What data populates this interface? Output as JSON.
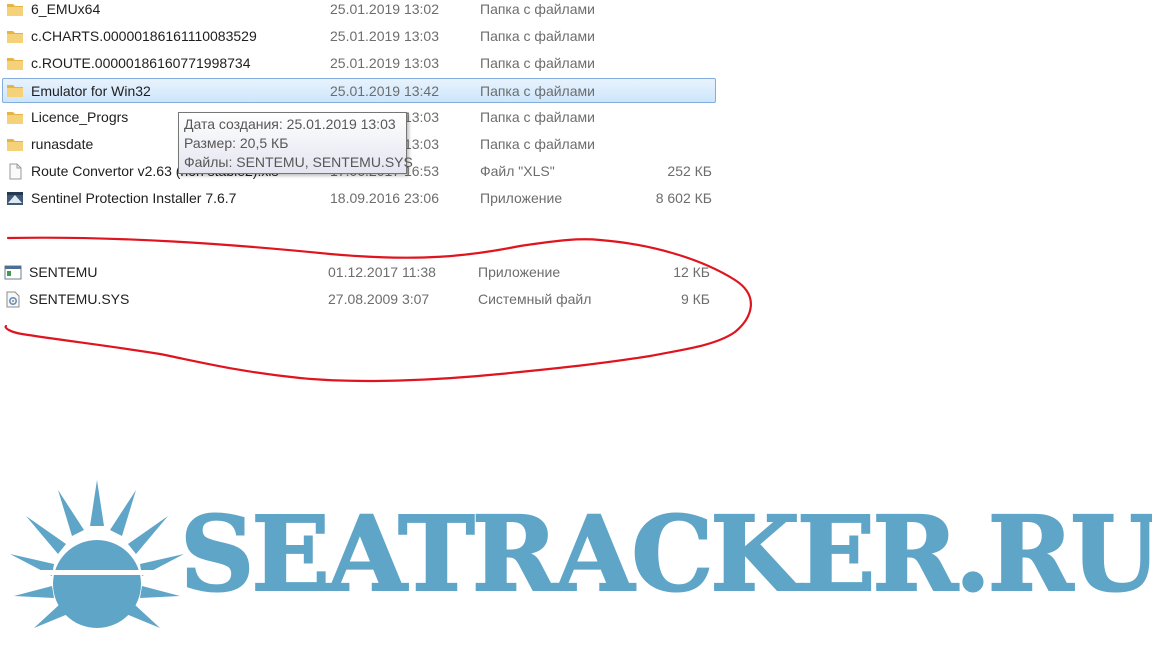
{
  "file_list": [
    {
      "name": "6_EMUx64",
      "date": "25.01.2019 13:02",
      "type": "Папка с файлами",
      "size": "",
      "icon": "folder-icon"
    },
    {
      "name": "c.CHARTS.00000186161110083529",
      "date": "25.01.2019 13:03",
      "type": "Папка с файлами",
      "size": "",
      "icon": "folder-icon"
    },
    {
      "name": "c.ROUTE.00000186160771998734",
      "date": "25.01.2019 13:03",
      "type": "Папка с файлами",
      "size": "",
      "icon": "folder-icon"
    },
    {
      "name": "Emulator for Win32",
      "date": "25.01.2019 13:42",
      "type": "Папка с файлами",
      "size": "",
      "icon": "folder-icon",
      "selected": true
    },
    {
      "name": "Licence_Progrs",
      "date": "25.01.2019 13:03",
      "type": "Папка с файлами",
      "size": "",
      "icon": "folder-icon"
    },
    {
      "name": "runasdate",
      "date": "25.01.2019 13:03",
      "type": "Папка с файлами",
      "size": "",
      "icon": "folder-icon"
    },
    {
      "name": "Route Convertor v2.63 (non stable2).xls",
      "date": "17.06.2017 16:53",
      "type": "Файл \"XLS\"",
      "size": "252 КБ",
      "icon": "document-icon"
    },
    {
      "name": "Sentinel Protection Installer 7.6.7",
      "date": "18.09.2016 23:06",
      "type": "Приложение",
      "size": "8 602 КБ",
      "icon": "installer-icon"
    }
  ],
  "folder_contents": [
    {
      "name": "SENTEMU",
      "date": "01.12.2017 11:38",
      "type": "Приложение",
      "size": "12 КБ",
      "icon": "application-icon"
    },
    {
      "name": "SENTEMU.SYS",
      "date": "27.08.2009 3:07",
      "type": "Системный файл",
      "size": "9 КБ",
      "icon": "system-file-icon"
    }
  ],
  "tooltip": {
    "line1": "Дата создания: 25.01.2019 13:03",
    "line2": "Размер: 20,5 КБ",
    "line3": "Файлы: SENTEMU, SENTEMU.SYS"
  },
  "watermark": {
    "text": "SEATRACKER.RU",
    "color": "#5fa5c8"
  },
  "colors": {
    "selection": "#cde6fb",
    "annotation": "#e0141e",
    "folder": "#f0c75a"
  }
}
